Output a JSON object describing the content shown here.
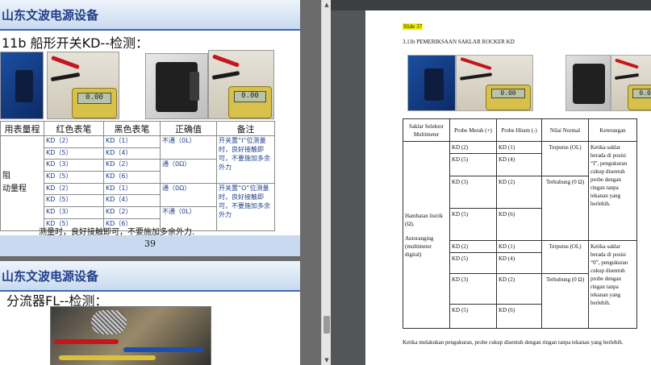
{
  "left": {
    "slide1": {
      "header": "山东文波电源设备",
      "title": "11b 船形开关KD--检测：",
      "table": {
        "headers": [
          "用表量程",
          "红色表笔",
          "黑色表笔",
          "正确值",
          "备注"
        ],
        "mode_labels": [
          "阻",
          "动量程"
        ],
        "rows": [
          {
            "red": "KD（2）",
            "black": "KD（1）"
          },
          {
            "red": "KD（5）",
            "black": "KD（4）"
          },
          {
            "red": "KD（3）",
            "black": "KD（2）"
          },
          {
            "red": "KD（5）",
            "black": "KD（6）"
          },
          {
            "red": "KD（2）",
            "black": "KD（1）"
          },
          {
            "red": "KD（5）",
            "black": "KD（4）"
          },
          {
            "red": "KD（3）",
            "black": "KD（2）"
          },
          {
            "red": "KD（5）",
            "black": "KD（6）"
          }
        ],
        "values": [
          "不通（0L）",
          "通（0Ω）",
          "通（0Ω）",
          "不通（0L）"
        ],
        "notes": [
          "开关置“I”位测量时，良好接触即可，不要施加多余外力",
          "开关置“O”位测量时，良好接触即可，不要施加多余外力"
        ]
      },
      "bottom_text": "测量时，良好接触即可，不要施加多余外力.",
      "page_number": "39"
    },
    "slide2": {
      "header": "山东文波电源设备",
      "title": "分流器FL--检测："
    },
    "meter_reading": "0.00"
  },
  "right": {
    "slide_label": "Slide 37",
    "heading": "3.11b PEMERIKSAAN SAKLAR ROCKER KD",
    "table": {
      "headers": [
        "Saklar Selektor Multimeter",
        "Probe Merah (+)",
        "Probe Hitam (-)",
        "Nilai Normal",
        "Keterangan"
      ],
      "mode": [
        "Hambatan listrik (Ω).",
        "Autoranging (multimeter digital)"
      ],
      "group1": {
        "rows": [
          {
            "red": "KD (2)",
            "black": "KD (1)"
          },
          {
            "red": "KD (5)",
            "black": "KD (4)"
          },
          {
            "red": "KD (3)",
            "black": "KD (2)"
          },
          {
            "red": "KD (5)",
            "black": "KD (6)"
          }
        ],
        "values": [
          "Terputus (OL)",
          "Terhubung (0 Ω)"
        ],
        "note": "Ketika saklar berada di posisi “I”, pengukuran cukup disentuh probe dengan ringan tanpa tekanan yang berlebih."
      },
      "group2": {
        "rows": [
          {
            "red": "KD (2)",
            "black": "KD (1)"
          },
          {
            "red": "KD (5)",
            "black": "KD (4)"
          },
          {
            "red": "KD (3)",
            "black": "KD (2)"
          },
          {
            "red": "KD (5)",
            "black": "KD (6)"
          }
        ],
        "values": [
          "Terputus (OL)",
          "Terhubung (0 Ω)"
        ],
        "note": "Ketika saklar berada di posisi “0”, pengukuran cukup disentuh probe dengan ringan tanpa tekanan yang berlebih."
      }
    },
    "footer": "Ketika melakukan pengukuran, probe cukup disentuh dengan ringan tanpa tekanan yang berlebih."
  },
  "scrollbar": {
    "up": "▲",
    "down": "▼"
  }
}
